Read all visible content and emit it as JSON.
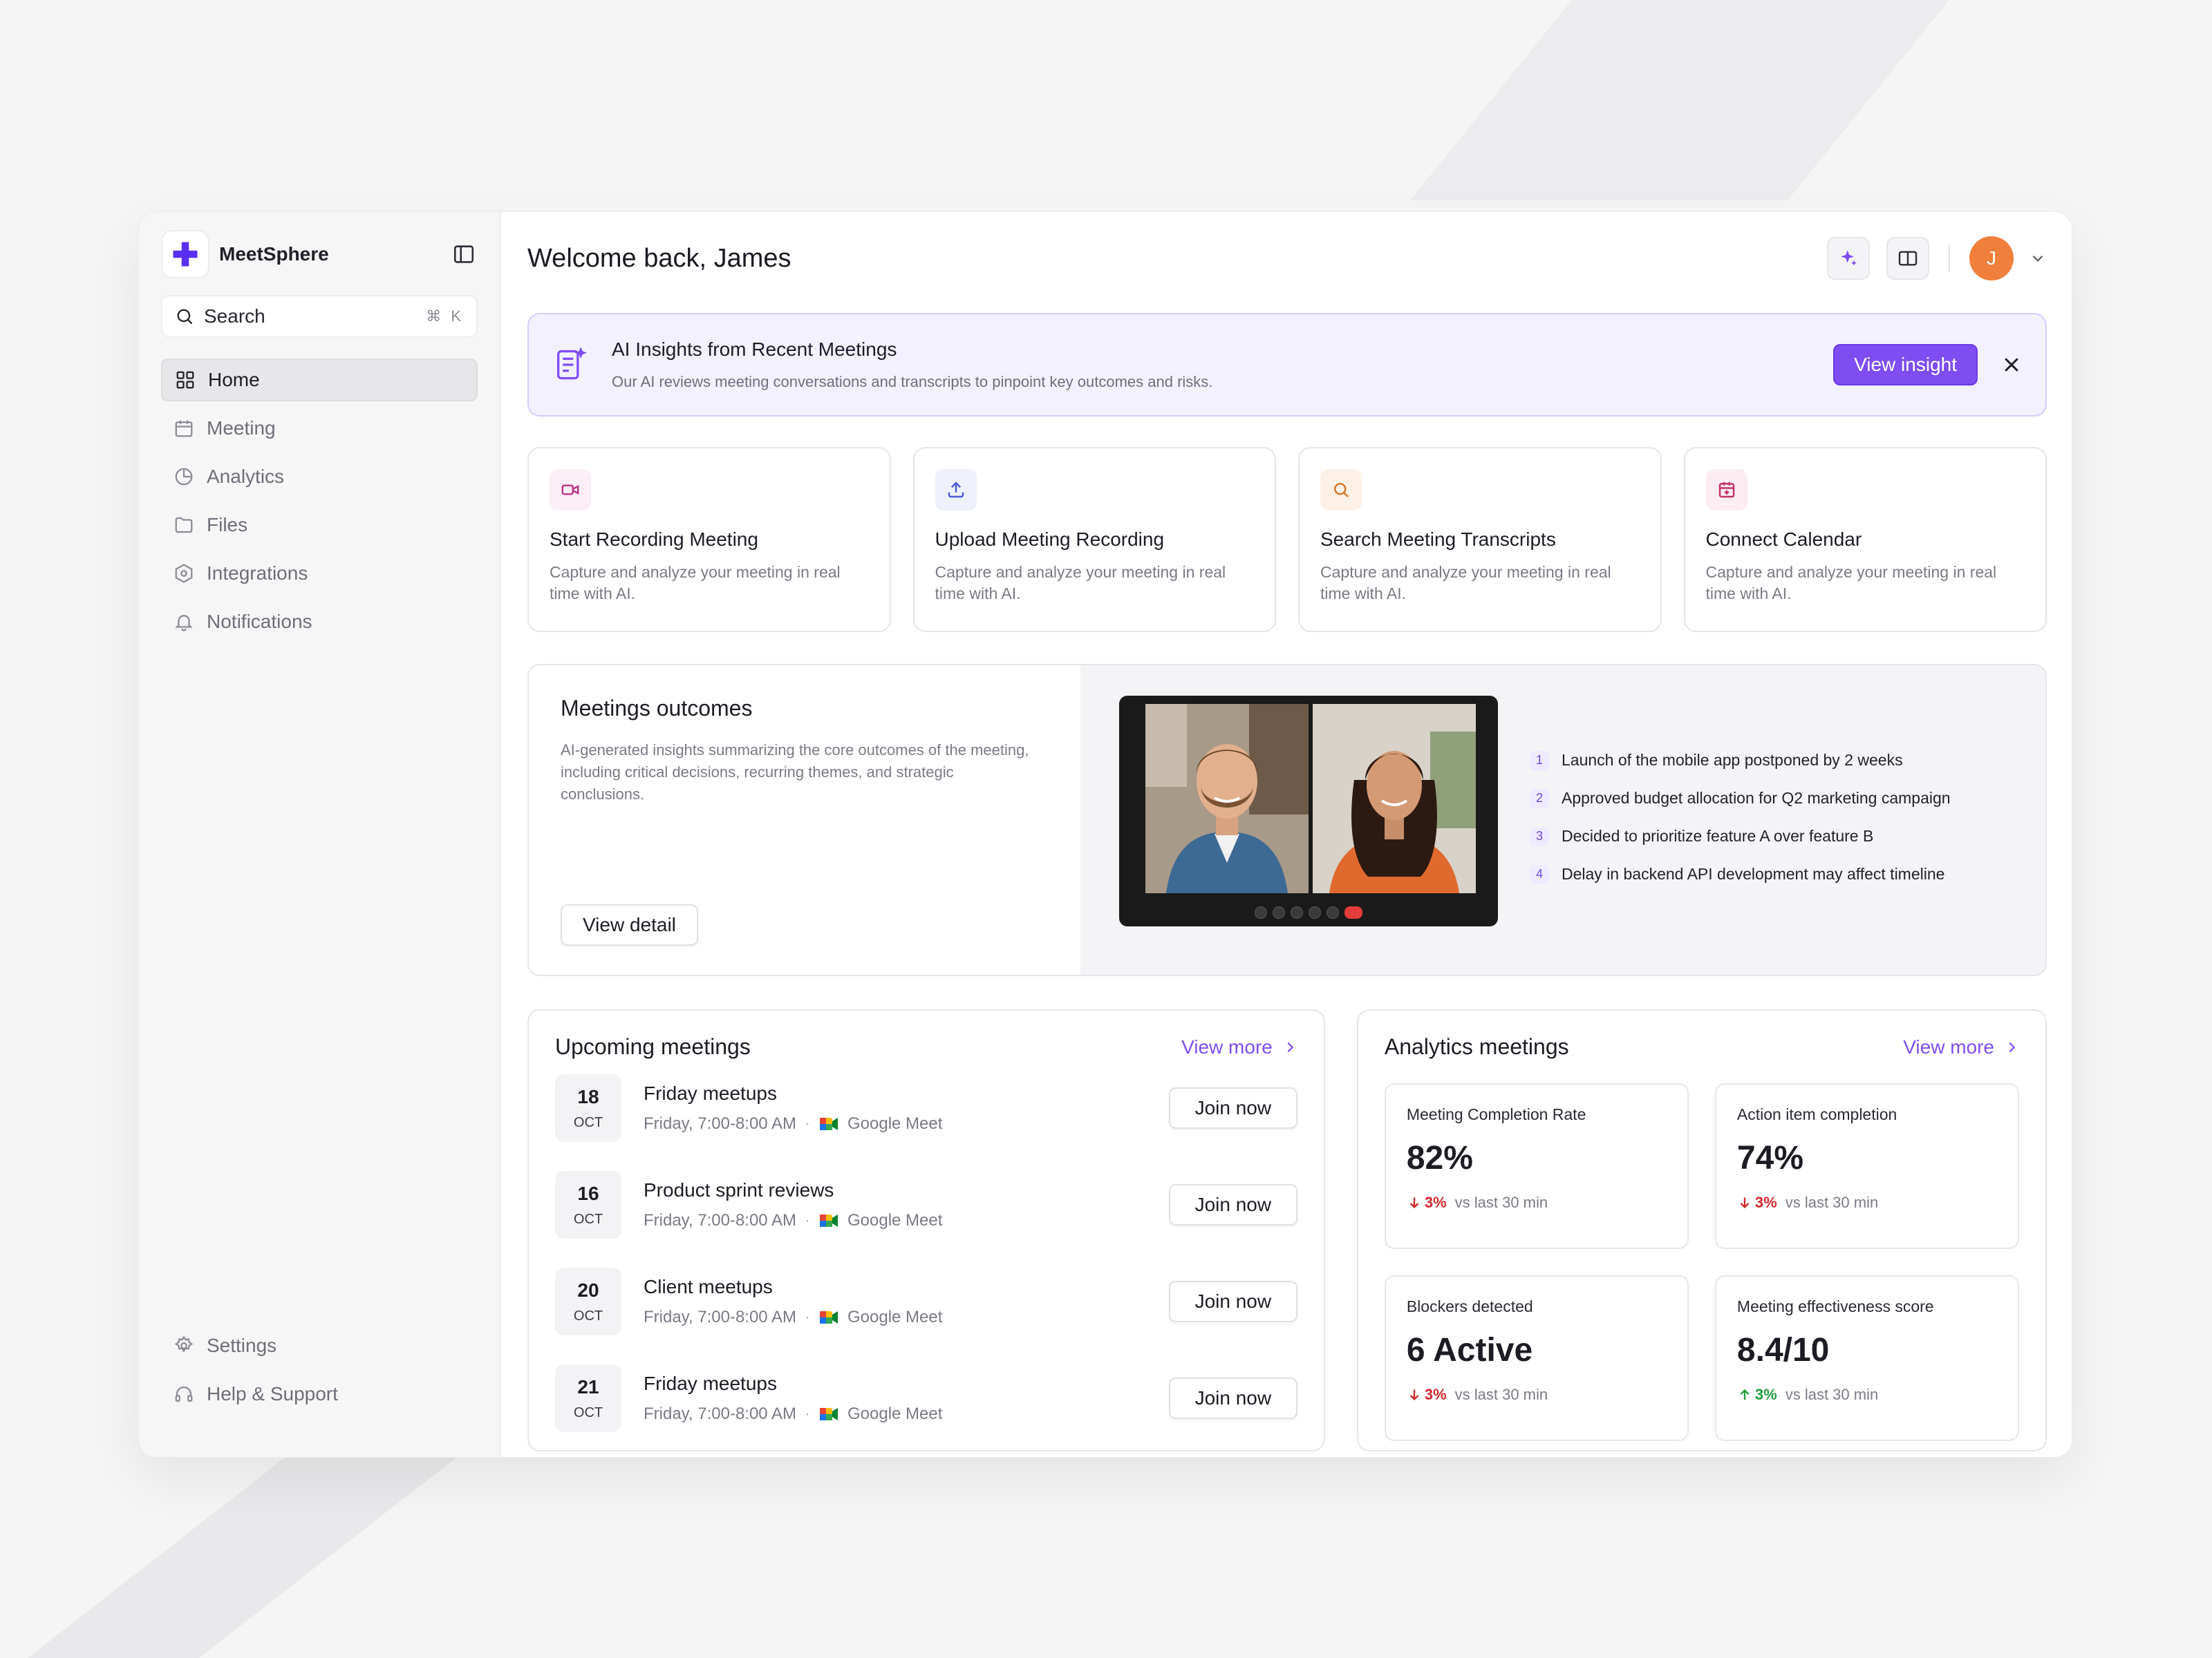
{
  "app": {
    "name": "MeetSphere"
  },
  "sidebar": {
    "search_label": "Search",
    "search_shortcut": "⌘ K",
    "items": [
      {
        "label": "Home",
        "icon": "grid-icon",
        "active": true
      },
      {
        "label": "Meeting",
        "icon": "calendar-icon"
      },
      {
        "label": "Analytics",
        "icon": "pie-chart-icon"
      },
      {
        "label": "Files",
        "icon": "folder-icon"
      },
      {
        "label": "Integrations",
        "icon": "integration-icon"
      },
      {
        "label": "Notifications",
        "icon": "bell-icon"
      }
    ],
    "bottom": [
      {
        "label": "Settings",
        "icon": "gear-icon"
      },
      {
        "label": "Help & Support",
        "icon": "headset-icon"
      }
    ]
  },
  "header": {
    "title": "Welcome back, James",
    "avatar_initial": "J"
  },
  "insight": {
    "title": "AI Insights from Recent Meetings",
    "subtitle": "Our AI reviews meeting conversations and transcripts to pinpoint key outcomes and risks.",
    "button": "View insight"
  },
  "quick_actions": [
    {
      "title": "Start Recording Meeting",
      "desc": "Capture and analyze your meeting in real time with AI.",
      "icon": "video-camera-icon",
      "color": "#b9388a",
      "bg": "#fbeef6"
    },
    {
      "title": "Upload Meeting Recording",
      "desc": "Capture and analyze your meeting in real time with AI.",
      "icon": "upload-icon",
      "color": "#4a5ad8",
      "bg": "#eef0fc"
    },
    {
      "title": "Search Meeting Transcripts",
      "desc": "Capture and analyze your meeting in real time with AI.",
      "icon": "search-icon",
      "color": "#d9772b",
      "bg": "#fdf1e7"
    },
    {
      "title": "Connect Calendar",
      "desc": "Capture and analyze your meeting in real time with AI.",
      "icon": "calendar-add-icon",
      "color": "#c43461",
      "bg": "#fcedf2"
    }
  ],
  "outcomes": {
    "title": "Meetings outcomes",
    "desc": "AI-generated insights summarizing the core outcomes of the meeting, including critical decisions, recurring themes, and strategic conclusions.",
    "button": "View detail",
    "items": [
      {
        "num": "1",
        "text": "Launch of the mobile app postponed by 2 weeks"
      },
      {
        "num": "2",
        "text": "Approved budget allocation for Q2 marketing campaign"
      },
      {
        "num": "3",
        "text": "Decided to prioritize feature A over feature B"
      },
      {
        "num": "4",
        "text": "Delay in backend API development may affect timeline"
      }
    ]
  },
  "upcoming": {
    "title": "Upcoming meetings",
    "view_more": "View more",
    "join_label": "Join now",
    "meetings": [
      {
        "day": "18",
        "month": "OCT",
        "title": "Friday meetups",
        "time": "Friday, 7:00-8:00 AM",
        "platform": "Google Meet"
      },
      {
        "day": "16",
        "month": "OCT",
        "title": "Product sprint reviews",
        "time": "Friday, 7:00-8:00 AM",
        "platform": "Google Meet"
      },
      {
        "day": "20",
        "month": "OCT",
        "title": "Client meetups",
        "time": "Friday, 7:00-8:00 AM",
        "platform": "Google Meet"
      },
      {
        "day": "21",
        "month": "OCT",
        "title": "Friday meetups",
        "time": "Friday, 7:00-8:00 AM",
        "platform": "Google Meet"
      }
    ]
  },
  "analytics": {
    "title": "Analytics meetings",
    "view_more": "View more",
    "stats": [
      {
        "label": "Meeting Completion Rate",
        "value": "82%",
        "trend": "3%",
        "direction": "down",
        "compare": "vs last 30 min"
      },
      {
        "label": "Action item completion",
        "value": "74%",
        "trend": "3%",
        "direction": "down",
        "compare": "vs last 30 min"
      },
      {
        "label": "Blockers detected",
        "value": "6 Active",
        "trend": "3%",
        "direction": "down",
        "compare": "vs last 30 min"
      },
      {
        "label": "Meeting effectiveness score",
        "value": "8.4/10",
        "trend": "3%",
        "direction": "up",
        "compare": "vs last 30 min"
      }
    ]
  },
  "colors": {
    "accent": "#7f4df2",
    "trend_down": "#d12a2a",
    "trend_up": "#1f9e3a",
    "avatar": "#f07f3c"
  }
}
